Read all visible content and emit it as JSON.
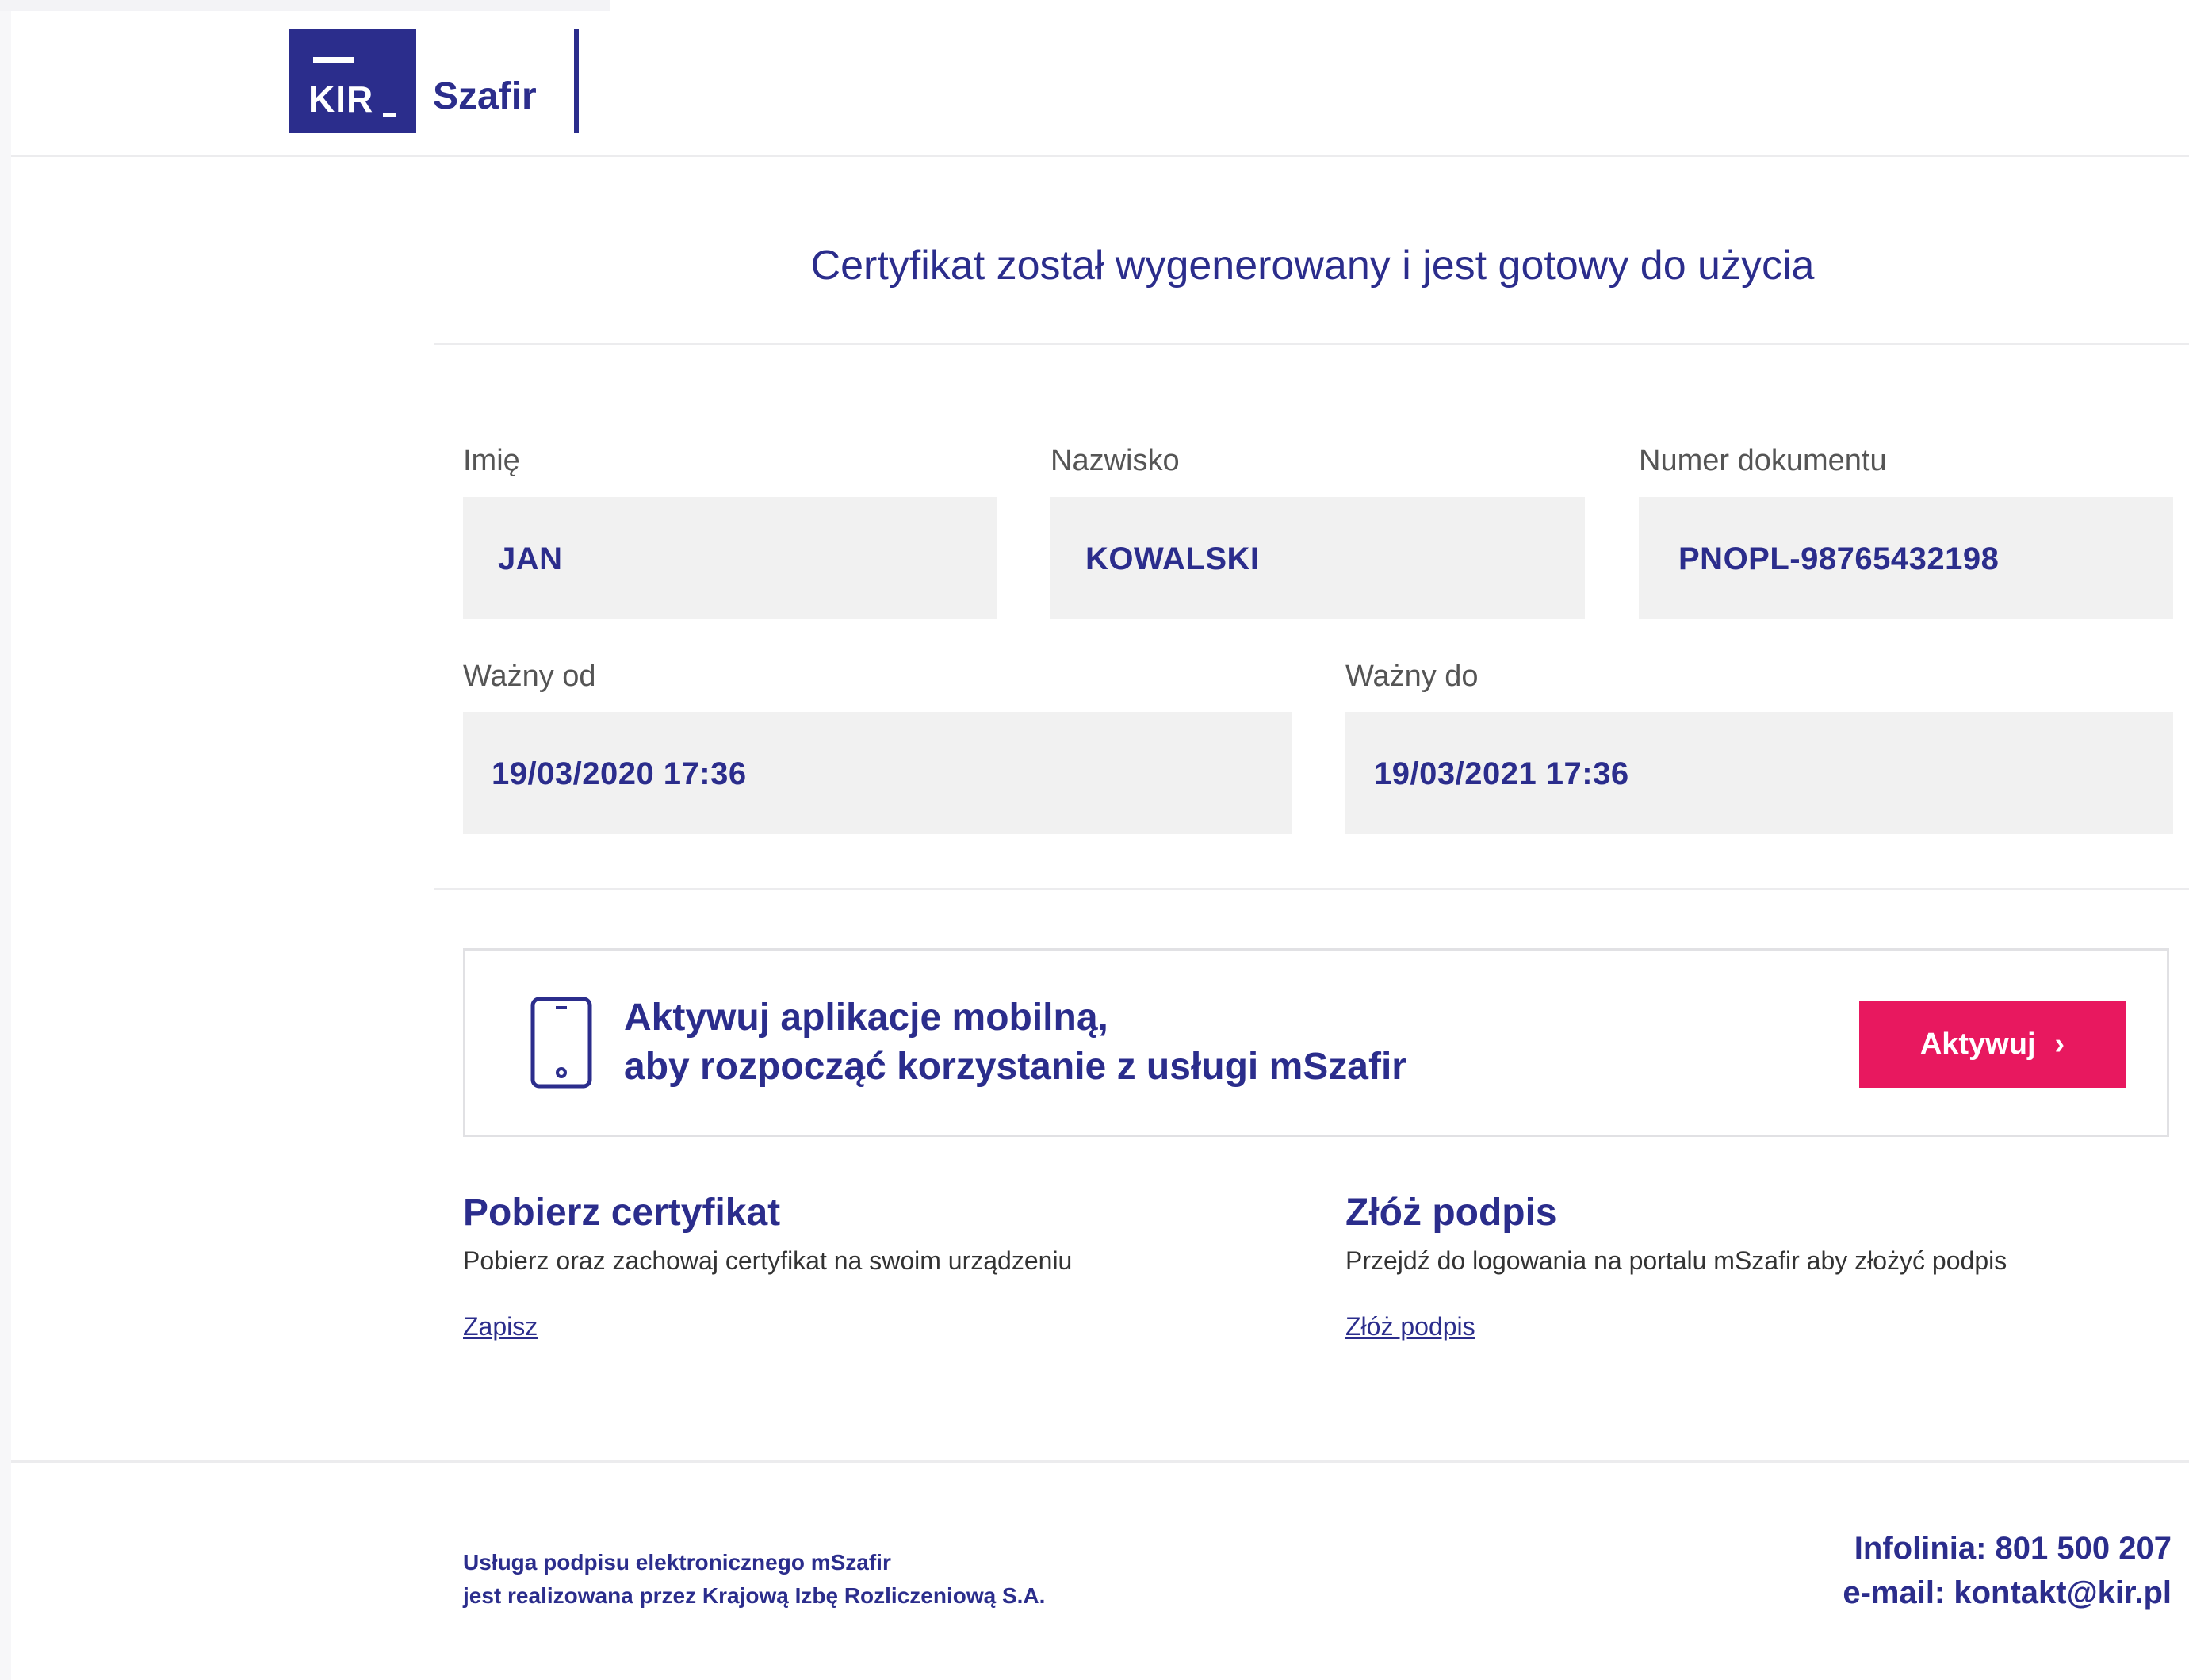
{
  "header": {
    "logo_text": "KIR",
    "brand_name": "Szafir"
  },
  "title": "Certyfikat został wygenerowany i jest gotowy do użycia",
  "fields": {
    "first_name": {
      "label": "Imię",
      "value": "JAN"
    },
    "last_name": {
      "label": "Nazwisko",
      "value": "KOWALSKI"
    },
    "document_number": {
      "label": "Numer dokumentu",
      "value": "PNOPL-98765432198"
    },
    "valid_from": {
      "label": "Ważny od",
      "value": "19/03/2020 17:36"
    },
    "valid_to": {
      "label": "Ważny do",
      "value": "19/03/2021 17:36"
    }
  },
  "banner": {
    "line1": "Aktywuj aplikacje mobilną,",
    "line2": "aby rozpocząć korzystanie z usługi mSzafir",
    "button_label": "Aktywuj",
    "button_color": "#e8185f"
  },
  "sections": {
    "download": {
      "title": "Pobierz certyfikat",
      "description": "Pobierz oraz zachowaj certyfikat na swoim urządzeniu",
      "link": "Zapisz"
    },
    "sign": {
      "title": "Złóż podpis",
      "description": "Przejdź do logowania na portalu mSzafir aby złożyć podpis",
      "link": "Złóż podpis"
    }
  },
  "footer": {
    "line1": "Usługa podpisu elektronicznego mSzafir",
    "line2": "jest realizowana przez Krajową Izbę Rozliczeniową S.A.",
    "hotline": "Infolinia: 801 500 207",
    "email": "e-mail: kontakt@kir.pl"
  },
  "colors": {
    "brand": "#2b2d8c",
    "accent": "#e8185f",
    "field_bg": "#f1f1f1"
  },
  "icons": [
    "kir-logo",
    "smartphone-icon",
    "chevron-right-icon"
  ]
}
